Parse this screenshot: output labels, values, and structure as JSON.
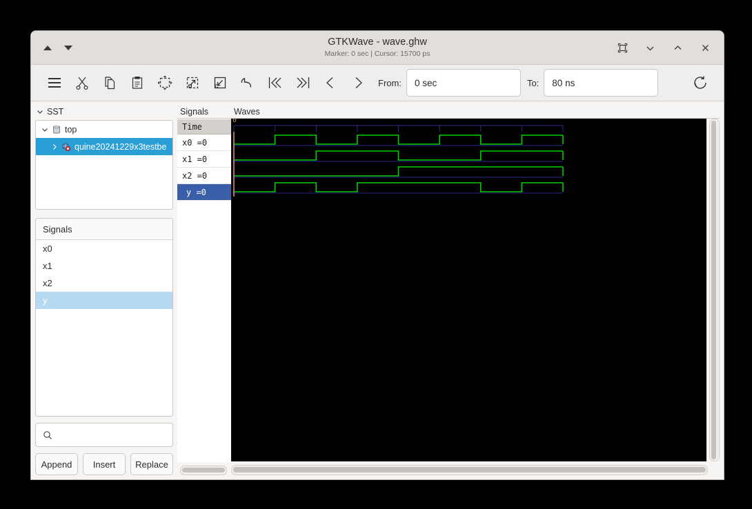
{
  "window": {
    "title": "GTKWave - wave.ghw",
    "subtitle": "Marker: 0 sec  |  Cursor: 15700 ps",
    "titlebar_buttons": [
      {
        "name": "scroll-up-button",
        "glyph": "up-triangle-icon"
      },
      {
        "name": "scroll-down-button",
        "glyph": "down-triangle-icon"
      }
    ],
    "controls": [
      {
        "name": "maximize-button",
        "glyph": "maximize-icon"
      },
      {
        "name": "minimize-button",
        "glyph": "chevron-down-icon"
      },
      {
        "name": "restore-button",
        "glyph": "chevron-up-icon"
      },
      {
        "name": "close-button",
        "glyph": "close-icon"
      }
    ]
  },
  "toolbar": {
    "icons": [
      "menu-icon",
      "cut-icon",
      "copy-icon",
      "paste-icon",
      "zoom-fit-icon",
      "zoom-out-icon",
      "zoom-in-icon",
      "undo-icon",
      "jump-start-icon",
      "jump-end-icon",
      "prev-edge-icon",
      "next-edge-icon"
    ],
    "reload_icon": "reload-icon",
    "from_label": "From:",
    "from_value": "0 sec",
    "to_label": "To:",
    "to_value": "80 ns"
  },
  "sst": {
    "header": "SST",
    "nodes": [
      {
        "label": "top",
        "icon": "module-icon",
        "expanded": true,
        "selected": false,
        "depth": 0
      },
      {
        "label": "quine20241229x3testbe",
        "icon": "instance-icon",
        "expanded": false,
        "selected": true,
        "depth": 1
      }
    ]
  },
  "signal_list": {
    "header": "Signals",
    "items": [
      {
        "label": "x0",
        "selected": false
      },
      {
        "label": "x1",
        "selected": false
      },
      {
        "label": "x2",
        "selected": false
      },
      {
        "label": "y",
        "selected": true
      }
    ]
  },
  "search": {
    "placeholder": "",
    "value": "",
    "icon": "search-icon"
  },
  "buttons": {
    "append": "Append",
    "insert": "Insert",
    "replace": "Replace"
  },
  "wave_names": {
    "header": "Signals",
    "time_label": "Time",
    "rows": [
      {
        "label": "x0 =0",
        "selected": false
      },
      {
        "label": "x1 =0",
        "selected": false
      },
      {
        "label": "x2 =0",
        "selected": false
      },
      {
        "label": "y =0",
        "selected": true
      }
    ]
  },
  "waves": {
    "header": "Waves",
    "origin_label": "0",
    "colors": {
      "background": "#000000",
      "trace": "#00d000",
      "grid": "#2a2a8c",
      "marker": "#ff9a9a"
    },
    "divisions": 8,
    "signals": [
      {
        "name": "x0",
        "values": [
          0,
          1,
          0,
          1,
          0,
          1,
          0,
          1
        ]
      },
      {
        "name": "x1",
        "values": [
          0,
          0,
          1,
          1,
          0,
          0,
          1,
          1
        ]
      },
      {
        "name": "x2",
        "values": [
          0,
          0,
          0,
          0,
          1,
          1,
          1,
          1
        ]
      },
      {
        "name": "y",
        "values": [
          0,
          1,
          0,
          1,
          1,
          1,
          0,
          1
        ]
      }
    ]
  },
  "scrollbars": {
    "left_h": "left-horizontal-scrollbar",
    "wave_h": "wave-horizontal-scrollbar",
    "wave_v": "wave-vertical-scrollbar"
  }
}
